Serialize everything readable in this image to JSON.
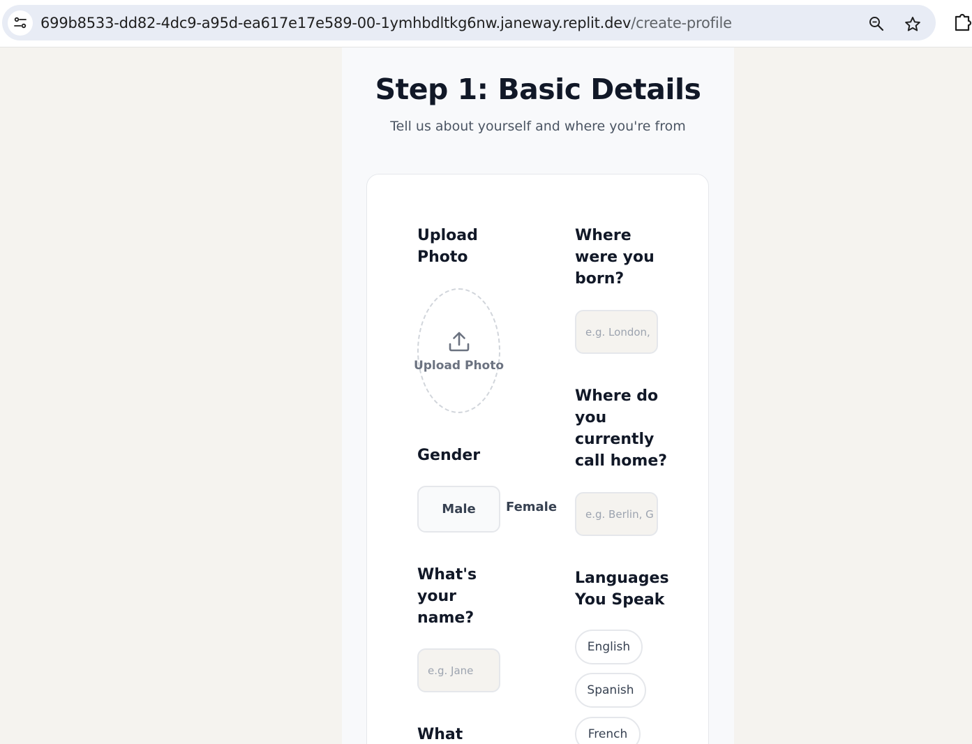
{
  "browser": {
    "url_host": "699b8533-dd82-4dc9-a95d-ea617e17e589-00-1ymhbdltkg6nw.janeway.replit.dev",
    "url_path": "/create-profile"
  },
  "header": {
    "title": "Step 1: Basic Details",
    "subtitle": "Tell us about yourself and where you're from"
  },
  "form": {
    "upload": {
      "label_line1": "Upload",
      "label_line2": "Photo",
      "button_text": "Upload Photo"
    },
    "born": {
      "label_line1": "Where",
      "label_line2": "were you",
      "label_line3": "born?",
      "placeholder": "e.g. London,"
    },
    "home": {
      "label_line1": "Where do",
      "label_line2": "you",
      "label_line3": "currently",
      "label_line4": "call home?",
      "placeholder": "e.g. Berlin, G"
    },
    "gender": {
      "label": "Gender",
      "options": [
        "Male",
        "Female"
      ]
    },
    "name": {
      "label_line1": "What's",
      "label_line2": "your",
      "label_line3": "name?",
      "placeholder": "e.g. Jane"
    },
    "languages": {
      "label_line1": "Languages",
      "label_line2": "You Speak",
      "options": [
        "English",
        "Spanish",
        "French"
      ]
    },
    "next_label_partial": "What"
  }
}
